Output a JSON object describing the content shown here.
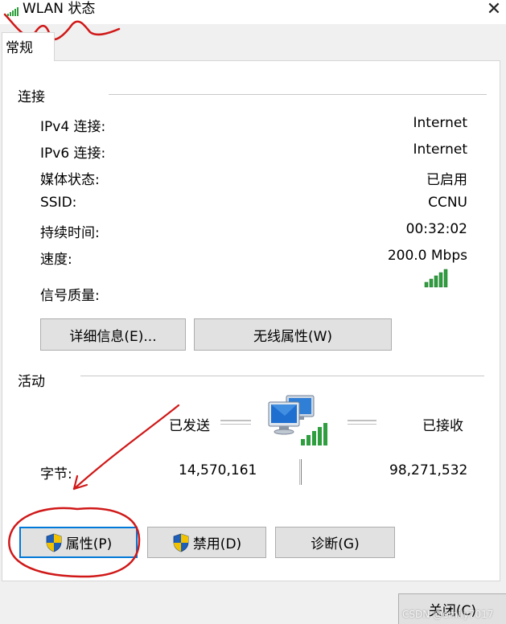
{
  "window": {
    "title": "WLAN 状态",
    "close_glyph": "✕"
  },
  "tabs": [
    {
      "label": "常规"
    }
  ],
  "connection": {
    "group_label": "连接",
    "rows": [
      {
        "label": "IPv4 连接:",
        "value": "Internet"
      },
      {
        "label": "IPv6 连接:",
        "value": "Internet"
      },
      {
        "label": "媒体状态:",
        "value": "已启用"
      },
      {
        "label": "SSID:",
        "value": "CCNU"
      },
      {
        "label": "持续时间:",
        "value": "00:32:02"
      },
      {
        "label": "速度:",
        "value": "200.0 Mbps"
      }
    ],
    "signal_label": "信号质量:",
    "signal_bars": 5,
    "details_button": "详细信息(E)...",
    "wireless_button": "无线属性(W)"
  },
  "activity": {
    "group_label": "活动",
    "sent_label": "已发送",
    "received_label": "已接收",
    "bytes_label": "字节:",
    "bytes_sent": "14,570,161",
    "bytes_received": "98,271,532"
  },
  "actions": {
    "properties_button": "属性(P)",
    "disable_button": "禁用(D)",
    "diagnose_button": "诊断(G)"
  },
  "footer": {
    "close_button": "关闭(C)"
  },
  "watermark": "CSDN @emily7017",
  "colors": {
    "signal": "#2e9e3e",
    "focus": "#0078d7",
    "annotation": "#d01818"
  },
  "icons": [
    "wifi-signal-icon",
    "close-icon",
    "network-computers-icon",
    "signal-strength-icon",
    "uac-shield-icon"
  ]
}
